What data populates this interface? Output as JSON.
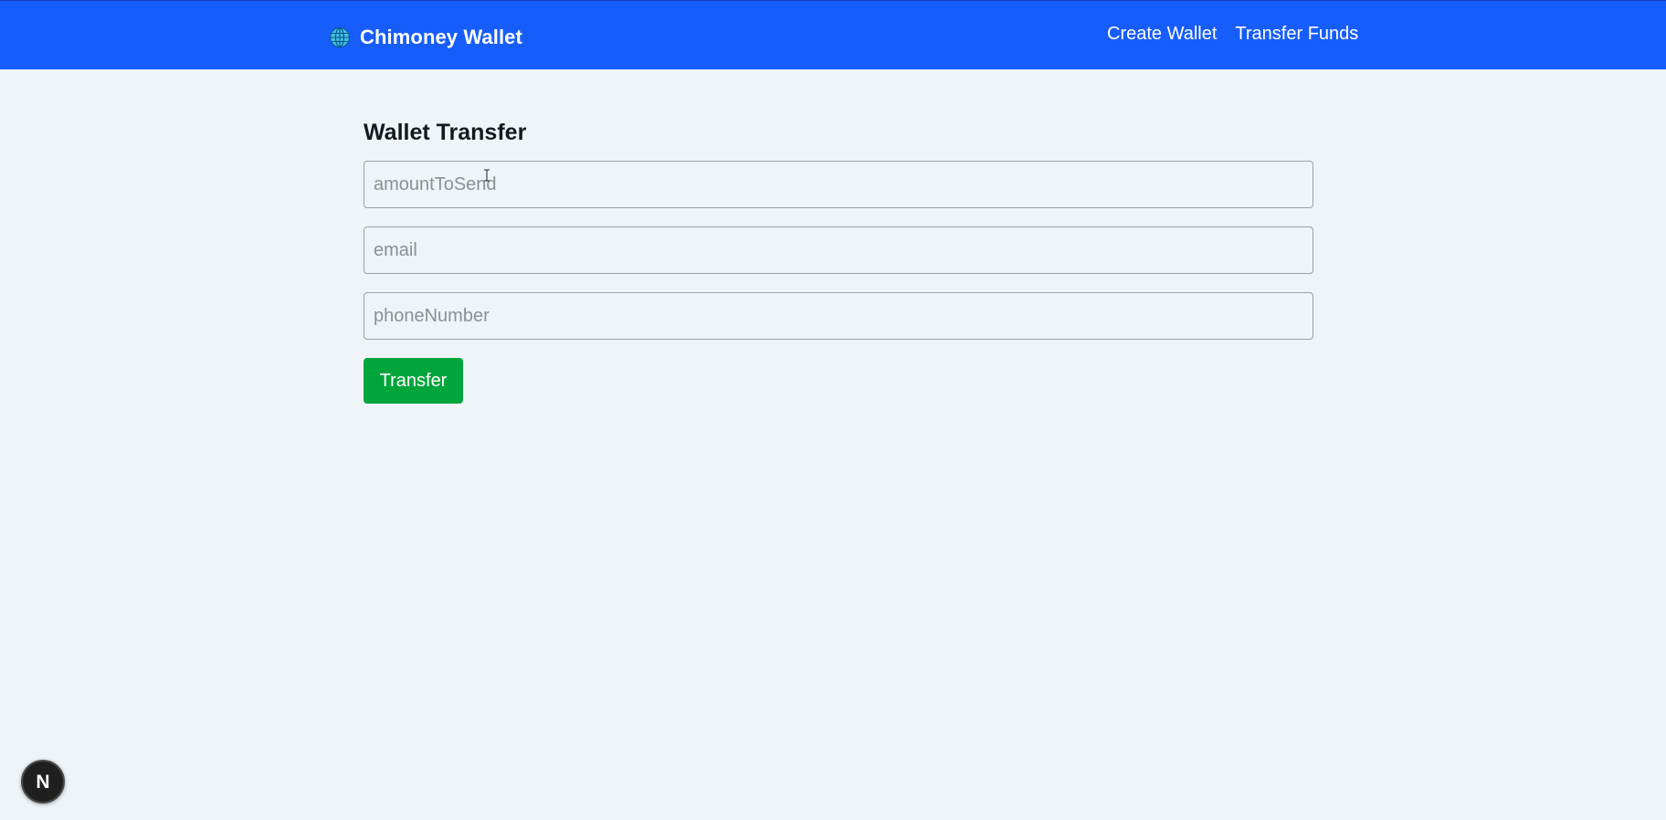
{
  "navbar": {
    "brand": {
      "icon": "globe-icon",
      "title": "Chimoney Wallet"
    },
    "links": [
      {
        "label": "Create Wallet"
      },
      {
        "label": "Transfer Funds"
      }
    ],
    "background_color": "#175dfb"
  },
  "form": {
    "title": "Wallet Transfer",
    "fields": [
      {
        "placeholder": "amountToSend",
        "value": ""
      },
      {
        "placeholder": "email",
        "value": ""
      },
      {
        "placeholder": "phoneNumber",
        "value": ""
      }
    ],
    "submit_label": "Transfer",
    "submit_color": "#00a53b"
  },
  "dev_badge": {
    "icon": "nextjs-icon",
    "letter": "N"
  }
}
